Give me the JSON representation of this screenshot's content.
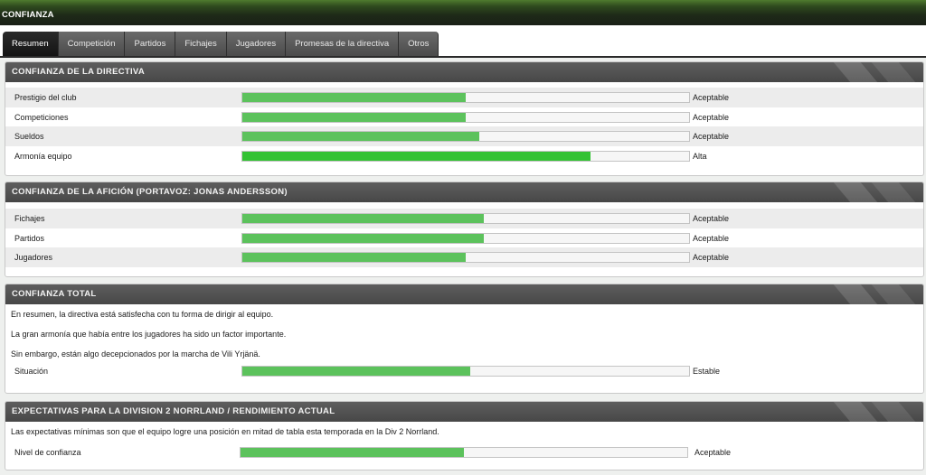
{
  "window": {
    "title": "CONFIANZA"
  },
  "tabs": [
    {
      "label": "Resumen",
      "active": true
    },
    {
      "label": "Competición",
      "active": false
    },
    {
      "label": "Partidos",
      "active": false
    },
    {
      "label": "Fichajes",
      "active": false
    },
    {
      "label": "Jugadores",
      "active": false
    },
    {
      "label": "Promesas de la directiva",
      "active": false
    },
    {
      "label": "Otros",
      "active": false
    }
  ],
  "directiva": {
    "title": "CONFIANZA DE LA DIRECTIVA",
    "rows": [
      {
        "label": "Prestigio del club",
        "level": 0.5,
        "value": "Aceptable"
      },
      {
        "label": "Competiciones",
        "level": 0.5,
        "value": "Aceptable"
      },
      {
        "label": "Sueldos",
        "level": 0.53,
        "value": "Aceptable"
      },
      {
        "label": "Armonía equipo",
        "level": 0.78,
        "value": "Alta"
      }
    ]
  },
  "aficion": {
    "title": "CONFIANZA DE LA AFICIÓN (PORTAVOZ: JONAS ANDERSSON)",
    "rows": [
      {
        "label": "Fichajes",
        "level": 0.54,
        "value": "Aceptable"
      },
      {
        "label": "Partidos",
        "level": 0.54,
        "value": "Aceptable"
      },
      {
        "label": "Jugadores",
        "level": 0.5,
        "value": "Aceptable"
      }
    ]
  },
  "total": {
    "title": "CONFIANZA TOTAL",
    "lines": [
      "En resumen, la directiva está satisfecha con tu forma de dirigir al equipo.",
      "La gran armonía que había entre los jugadores ha sido un factor importante.",
      "Sin embargo, están algo decepcionados por la marcha de Vili Yrjänä."
    ],
    "situacion": {
      "label": "Situación",
      "level": 0.51,
      "value": "Estable"
    }
  },
  "expectativas": {
    "title": "EXPECTATIVAS PARA LA DIVISION 2 NORRLAND / RENDIMIENTO ACTUAL",
    "text": "Las expectativas mínimas son que el equipo logre una posición en mitad de tabla esta temporada en la Div 2 Norrland.",
    "nivel": {
      "label": "Nivel de confianza",
      "level": 0.5,
      "value": "Aceptable"
    }
  },
  "colors": {
    "bar_fill": "#5cc25c",
    "bar_fill_high": "#33c233",
    "header_bg": "#4f4f4f",
    "active_tab": "#1c1c1c"
  }
}
